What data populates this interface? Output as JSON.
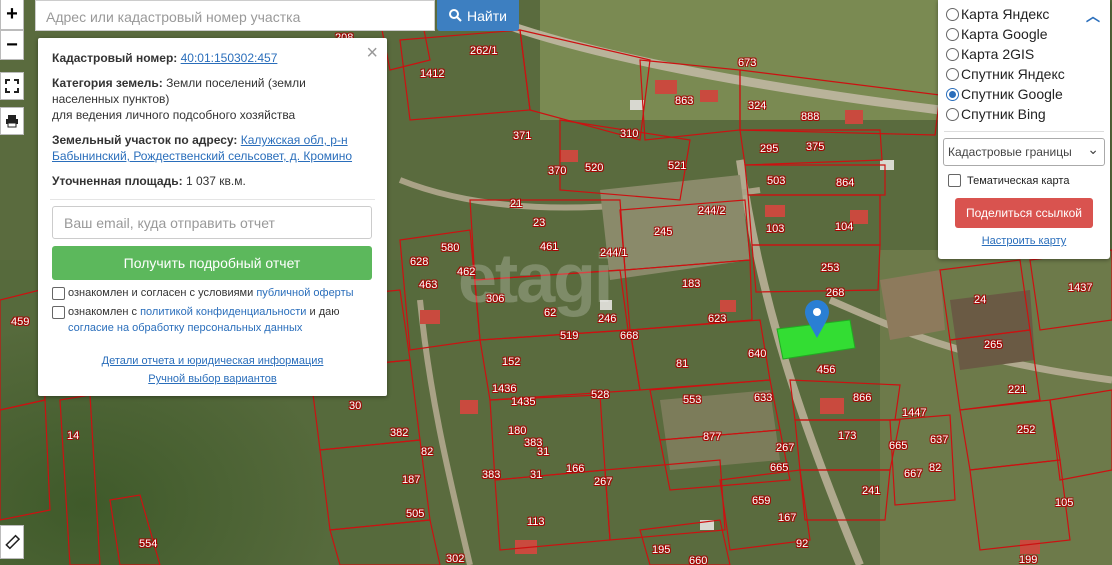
{
  "search": {
    "placeholder": "Адрес или кадастровый номер участка",
    "button_label": "Найти"
  },
  "controls": {
    "zoom_in": "+",
    "zoom_out": "−"
  },
  "popup": {
    "close": "×",
    "cadastral_label": "Кадастровый номер:",
    "cadastral_value": "40:01:150302:457",
    "category_label": "Категория земель:",
    "category_value": "Земли поселений (земли населенных пунктов)",
    "category_use": "для ведения личного подсобного хозяйства",
    "address_label": "Земельный участок по адресу:",
    "address_value": "Калужская обл, р-н Бабынинский, Рождественский сельсовет, д. Кромино",
    "area_label": "Уточненная площадь:",
    "area_value": "1 037 кв.м.",
    "email_placeholder": "Ваш email, куда отправить отчет",
    "report_button": "Получить подробный отчет",
    "consent1_text": "ознакомлен и согласен с условиями",
    "consent1_link": "публичной оферты",
    "consent2_text": "ознакомлен с",
    "consent2_link": "политикой конфиденциальности",
    "consent2_mid": "и даю",
    "consent2_link2": "согласие на обработку персональных данных",
    "details_link": "Детали отчета и юридическая информация",
    "manual_link": "Ручной выбор вариантов"
  },
  "panel": {
    "layers": [
      {
        "label": "Карта Яндекс",
        "selected": false
      },
      {
        "label": "Карта Google",
        "selected": false
      },
      {
        "label": "Карта 2GIS",
        "selected": false
      },
      {
        "label": "Спутник Яндекс",
        "selected": false
      },
      {
        "label": "Спутник Google",
        "selected": true
      },
      {
        "label": "Спутник Bing",
        "selected": false
      }
    ],
    "overlay_select": "Кадастровые границы",
    "thematic_label": "Тематическая карта",
    "share_button": "Поделиться ссылкой",
    "config_link": "Настроить карту"
  },
  "map": {
    "watermark": "etagi",
    "accent_color": "#2a6ebb",
    "selected_parcel_color": "#33dd33",
    "boundary_color": "#cc1111",
    "parcel_labels": [
      "208",
      "262/1",
      "1412",
      "673",
      "863",
      "324",
      "888",
      "310",
      "371",
      "520",
      "370",
      "295",
      "375",
      "521",
      "503",
      "864",
      "21",
      "244/2",
      "23",
      "103",
      "104",
      "245",
      "461",
      "244/1",
      "253",
      "628",
      "580",
      "462",
      "463",
      "306",
      "183",
      "268",
      "24",
      "1437",
      "459",
      "62",
      "246",
      "623",
      "519",
      "668",
      "265",
      "152",
      "81",
      "640",
      "456",
      "1436",
      "221",
      "1435",
      "528",
      "553",
      "633",
      "866",
      "30",
      "1447",
      "180",
      "383",
      "252",
      "382",
      "877",
      "173",
      "665",
      "637",
      "82",
      "31",
      "267",
      "383",
      "31",
      "166",
      "267",
      "665",
      "667",
      "82",
      "187",
      "241",
      "105",
      "505",
      "659",
      "167",
      "113",
      "554",
      "302",
      "195",
      "660",
      "92",
      "199",
      "14"
    ]
  }
}
